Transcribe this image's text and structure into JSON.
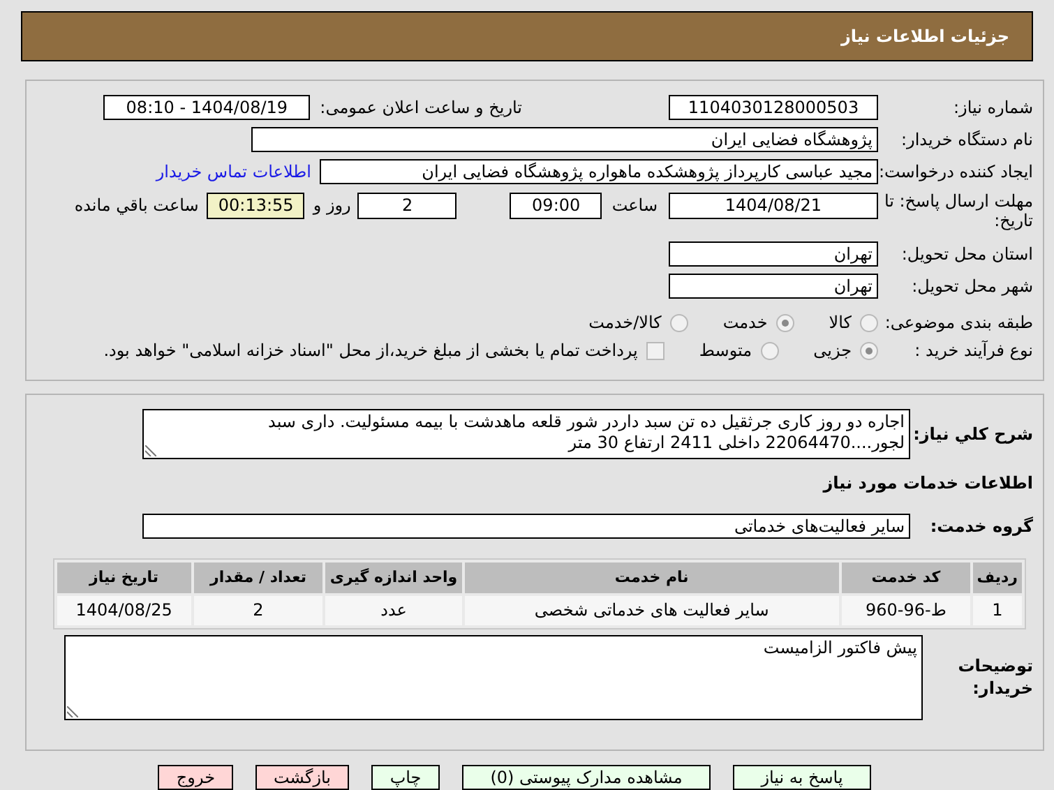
{
  "header": {
    "title": "جزئیات اطلاعات نیاز"
  },
  "info": {
    "need_number": {
      "label": "شماره نیاز:",
      "value": "1104030128000503"
    },
    "announce": {
      "label": "تاریخ و ساعت اعلان عمومی:",
      "value": "1404/08/19 - 08:10"
    },
    "buyer": {
      "label": "نام دستگاه خریدار:",
      "value": "پژوهشگاه فضایی ایران"
    },
    "requester": {
      "label": "ایجاد کننده درخواست:",
      "value": "مجید عباسی کارپرداز پژوهشکده ماهواره پژوهشگاه فضایی ایران",
      "link": "اطلاعات تماس خریدار"
    },
    "deadline": {
      "label": "مهلت ارسال پاسخ: تا تاریخ:",
      "date": "1404/08/21",
      "time_label": "ساعت",
      "time": "09:00",
      "days": "2",
      "days_label": "روز و",
      "remaining": "00:13:55",
      "remaining_label": "ساعت باقي مانده"
    },
    "province": {
      "label": "استان محل تحویل:",
      "value": "تهران"
    },
    "city": {
      "label": "شهر محل تحویل:",
      "value": "تهران"
    },
    "category": {
      "label": "طبقه بندی موضوعی:",
      "options": [
        {
          "label": "کالا",
          "selected": false
        },
        {
          "label": "خدمت",
          "selected": true
        },
        {
          "label": "کالا/خدمت",
          "selected": false
        }
      ]
    },
    "purchase_type": {
      "label": "نوع فرآیند خرید :",
      "options": [
        {
          "label": "جزیی",
          "selected": true
        },
        {
          "label": "متوسط",
          "selected": false
        }
      ],
      "payment": {
        "label": "پرداخت تمام یا بخشی از مبلغ خرید،از محل \"اسناد خزانه اسلامی\" خواهد بود.",
        "checked": false
      }
    }
  },
  "services": {
    "description": {
      "label": "شرح کلي نیاز:",
      "value": "اجاره دو روز کاری جرثقیل ده تن  سبد داردر شور قلعه ماهدشت با بیمه مسئولیت. داری سبد لجور....22064470 داخلی 2411 ارتفاع 30 متر"
    },
    "heading": "اطلاعات خدمات مورد نیاز",
    "group": {
      "label": "گروه خدمت:",
      "value": "سایر فعالیت‌های خدماتی"
    },
    "table": {
      "columns": [
        "ردیف",
        "کد خدمت",
        "نام خدمت",
        "واحد اندازه گیری",
        "تعداد / مقدار",
        "تاریخ نیاز"
      ],
      "rows": [
        [
          "1",
          "ط-96-960",
          "سایر فعالیت های خدماتی شخصی",
          "عدد",
          "2",
          "1404/08/25"
        ]
      ]
    },
    "notes": {
      "label": "توضیحات خریدار:",
      "value": "پیش فاکتور الزامیست"
    }
  },
  "buttons": [
    {
      "label": "پاسخ به نیاز",
      "kind": "normal"
    },
    {
      "label": "مشاهده مدارک پیوستی (0)",
      "kind": "normal"
    },
    {
      "label": "چاپ",
      "kind": "normal"
    },
    {
      "label": "بازگشت",
      "kind": "danger"
    },
    {
      "label": "خروج",
      "kind": "danger"
    }
  ]
}
